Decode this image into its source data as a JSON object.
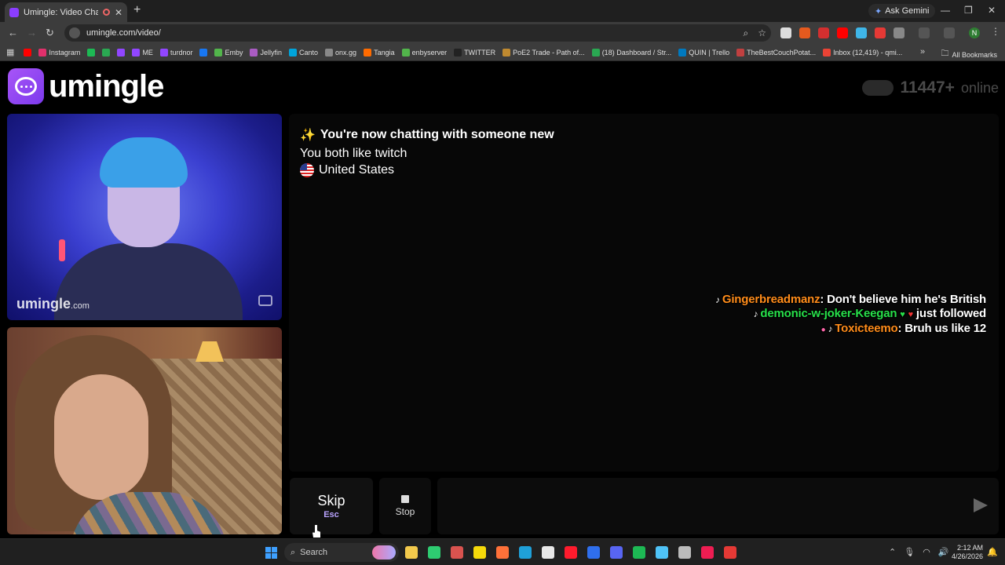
{
  "browser": {
    "tab_title": "Umingle: Video Chat with S",
    "tab_close": "✕",
    "new_tab": "+",
    "gemini": "Ask Gemini",
    "url": "umingle.com/video/",
    "window_controls": [
      "—",
      "❐",
      "✕"
    ],
    "profile_initial": "N",
    "bookmarks": [
      {
        "label": "",
        "color": "#ff0000"
      },
      {
        "label": "Instagram",
        "color": "#e1306c"
      },
      {
        "label": "",
        "color": "#1db954"
      },
      {
        "label": "",
        "color": "#2aa852"
      },
      {
        "label": "",
        "color": "#9146ff"
      },
      {
        "label": "ME",
        "color": "#9146ff"
      },
      {
        "label": "turdnor",
        "color": "#9146ff"
      },
      {
        "label": "",
        "color": "#1877f2"
      },
      {
        "label": "Emby",
        "color": "#52b54b"
      },
      {
        "label": "Jellyfin",
        "color": "#aa5cc3"
      },
      {
        "label": "Canto",
        "color": "#00a4db"
      },
      {
        "label": "onx.gg",
        "color": "#888888"
      },
      {
        "label": "Tangia",
        "color": "#ff6b00"
      },
      {
        "label": "enbyserver",
        "color": "#52b54b"
      },
      {
        "label": "TWITTER",
        "color": "#222222"
      },
      {
        "label": "PoE2 Trade - Path of...",
        "color": "#c08a30"
      },
      {
        "label": "(18) Dashboard / Str...",
        "color": "#2aa852"
      },
      {
        "label": "QUIN | Trello",
        "color": "#0079bf"
      },
      {
        "label": "TheBestCouchPotat...",
        "color": "#c04040"
      },
      {
        "label": "Inbox (12,419) - qmi...",
        "color": "#ea4335"
      }
    ],
    "all_bookmarks": "All Bookmarks"
  },
  "site": {
    "logo": "umingle",
    "online_count": "11447+",
    "online_word": "online"
  },
  "videos": {
    "watermark": "umingle",
    "watermark_suffix": ".com"
  },
  "chat": {
    "sparkle": "✨",
    "line1": "You're now chatting with someone new",
    "line2": "You both like twitch",
    "line3": "United States"
  },
  "stream_overlay": {
    "messages": [
      {
        "user": "Gingerbreadmanz",
        "text": ": Don't believe him he's British"
      },
      {
        "user": "demonic-w-joker-Keegan",
        "text": "just followed"
      },
      {
        "user": "Toxicteemo",
        "text": ": Bruh us like 12"
      }
    ]
  },
  "controls": {
    "skip_label": "Skip",
    "skip_key": "Esc",
    "stop_label": "Stop",
    "message_placeholder": ""
  },
  "taskbar": {
    "search_label": "Search",
    "time": "2:12 AM",
    "date": "4/26/2026",
    "apps": [
      {
        "name": "file-explorer",
        "color": "#f2c94c"
      },
      {
        "name": "media",
        "color": "#2ecc71"
      },
      {
        "name": "app-red",
        "color": "#d9534f"
      },
      {
        "name": "sticky",
        "color": "#f5d90a"
      },
      {
        "name": "firefox",
        "color": "#ff7139"
      },
      {
        "name": "edge",
        "color": "#1fa0d8"
      },
      {
        "name": "chrome",
        "color": "#e8e8e8"
      },
      {
        "name": "opera",
        "color": "#ff1b2d"
      },
      {
        "name": "app-blue",
        "color": "#2f6fed"
      },
      {
        "name": "discord",
        "color": "#5865f2"
      },
      {
        "name": "spotify",
        "color": "#1db954"
      },
      {
        "name": "notepad",
        "color": "#4fc3f7"
      },
      {
        "name": "obs",
        "color": "#bbbbbb"
      },
      {
        "name": "tiktok",
        "color": "#ee1d52"
      },
      {
        "name": "app-red2",
        "color": "#e53935"
      }
    ]
  }
}
